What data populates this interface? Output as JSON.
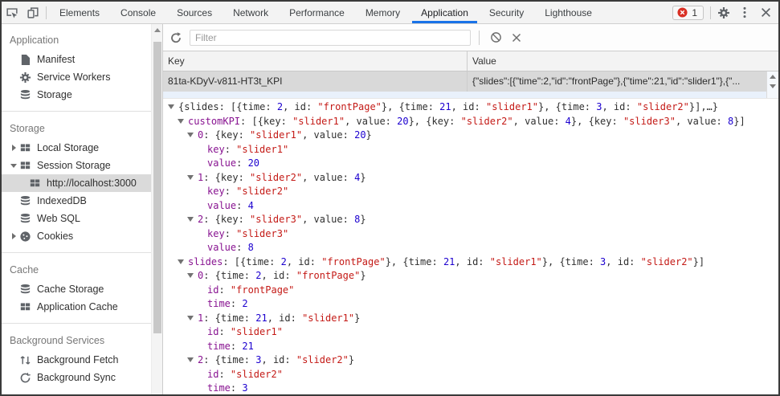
{
  "colors": {
    "accent_blue": "#1a73e8",
    "error_red": "#d93025",
    "syntax_key_purple": "#881391",
    "syntax_string_red": "#c41a16",
    "syntax_number_blue": "#1c00cf",
    "selected_row_gray": "#d9d9d9",
    "row_stripe_blue": "#e9f1fb"
  },
  "tabbar": {
    "tabs": [
      "Elements",
      "Console",
      "Sources",
      "Network",
      "Performance",
      "Memory",
      "Application",
      "Security",
      "Lighthouse"
    ],
    "active_tab": "Application",
    "error_badge_count": "1",
    "icons_left": [
      "inspect-icon",
      "device-toolbar-icon"
    ],
    "icons_right": [
      "settings-gear-icon",
      "more-menu-icon",
      "close-icon"
    ]
  },
  "sidebar": {
    "sections": [
      {
        "title": "Application",
        "items": [
          {
            "label": "Manifest",
            "icon": "file-icon"
          },
          {
            "label": "Service Workers",
            "icon": "gear-icon"
          },
          {
            "label": "Storage",
            "icon": "database-icon"
          }
        ]
      },
      {
        "title": "Storage",
        "items": [
          {
            "label": "Local Storage",
            "icon": "grid-icon",
            "expander": "collapsed"
          },
          {
            "label": "Session Storage",
            "icon": "grid-icon",
            "expander": "expanded"
          },
          {
            "label": "http://localhost:3000",
            "icon": "grid-icon",
            "selected": true,
            "child": true
          },
          {
            "label": "IndexedDB",
            "icon": "database-icon"
          },
          {
            "label": "Web SQL",
            "icon": "database-icon"
          },
          {
            "label": "Cookies",
            "icon": "cookie-icon",
            "expander": "collapsed"
          }
        ]
      },
      {
        "title": "Cache",
        "items": [
          {
            "label": "Cache Storage",
            "icon": "database-icon"
          },
          {
            "label": "Application Cache",
            "icon": "grid-icon"
          }
        ]
      },
      {
        "title": "Background Services",
        "items": [
          {
            "label": "Background Fetch",
            "icon": "fetch-icon"
          },
          {
            "label": "Background Sync",
            "icon": "sync-icon"
          }
        ]
      }
    ]
  },
  "main": {
    "toolbar": {
      "filter_placeholder": "Filter",
      "icons": [
        "refresh-icon",
        "block-icon",
        "delete-icon"
      ]
    },
    "grid": {
      "columns": [
        "Key",
        "Value"
      ],
      "selected_row": {
        "key": "81ta-KDyV-v811-HT3t_KPI",
        "value": "{\"slides\":[{\"time\":2,\"id\":\"frontPage\"},{\"time\":21,\"id\":\"slider1\"},{\"..."
      }
    },
    "preview_tree": {
      "lines": [
        {
          "i": 0,
          "e": 1,
          "s": [
            [
              "p",
              "{slides: [{time: "
            ],
            [
              "n",
              "2"
            ],
            [
              "p",
              ", id: "
            ],
            [
              "s",
              "\"frontPage\""
            ],
            [
              "p",
              "}, {time: "
            ],
            [
              "n",
              "21"
            ],
            [
              "p",
              ", id: "
            ],
            [
              "s",
              "\"slider1\""
            ],
            [
              "p",
              "}, {time: "
            ],
            [
              "n",
              "3"
            ],
            [
              "p",
              ", id: "
            ],
            [
              "s",
              "\"slider2\""
            ],
            [
              "p",
              "}],…}"
            ]
          ]
        },
        {
          "i": 1,
          "e": 1,
          "s": [
            [
              "k",
              "customKPI"
            ],
            [
              "p",
              ": [{key: "
            ],
            [
              "s",
              "\"slider1\""
            ],
            [
              "p",
              ", value: "
            ],
            [
              "n",
              "20"
            ],
            [
              "p",
              "}, {key: "
            ],
            [
              "s",
              "\"slider2\""
            ],
            [
              "p",
              ", value: "
            ],
            [
              "n",
              "4"
            ],
            [
              "p",
              "}, {key: "
            ],
            [
              "s",
              "\"slider3\""
            ],
            [
              "p",
              ", value: "
            ],
            [
              "n",
              "8"
            ],
            [
              "p",
              "}]"
            ]
          ]
        },
        {
          "i": 2,
          "e": 1,
          "s": [
            [
              "k",
              "0"
            ],
            [
              "p",
              ": {key: "
            ],
            [
              "s",
              "\"slider1\""
            ],
            [
              "p",
              ", value: "
            ],
            [
              "n",
              "20"
            ],
            [
              "p",
              "}"
            ]
          ]
        },
        {
          "i": 3,
          "e": 0,
          "s": [
            [
              "k",
              "key"
            ],
            [
              "p",
              ": "
            ],
            [
              "s",
              "\"slider1\""
            ]
          ]
        },
        {
          "i": 3,
          "e": 0,
          "s": [
            [
              "k",
              "value"
            ],
            [
              "p",
              ": "
            ],
            [
              "n",
              "20"
            ]
          ]
        },
        {
          "i": 2,
          "e": 1,
          "s": [
            [
              "k",
              "1"
            ],
            [
              "p",
              ": {key: "
            ],
            [
              "s",
              "\"slider2\""
            ],
            [
              "p",
              ", value: "
            ],
            [
              "n",
              "4"
            ],
            [
              "p",
              "}"
            ]
          ]
        },
        {
          "i": 3,
          "e": 0,
          "s": [
            [
              "k",
              "key"
            ],
            [
              "p",
              ": "
            ],
            [
              "s",
              "\"slider2\""
            ]
          ]
        },
        {
          "i": 3,
          "e": 0,
          "s": [
            [
              "k",
              "value"
            ],
            [
              "p",
              ": "
            ],
            [
              "n",
              "4"
            ]
          ]
        },
        {
          "i": 2,
          "e": 1,
          "s": [
            [
              "k",
              "2"
            ],
            [
              "p",
              ": {key: "
            ],
            [
              "s",
              "\"slider3\""
            ],
            [
              "p",
              ", value: "
            ],
            [
              "n",
              "8"
            ],
            [
              "p",
              "}"
            ]
          ]
        },
        {
          "i": 3,
          "e": 0,
          "s": [
            [
              "k",
              "key"
            ],
            [
              "p",
              ": "
            ],
            [
              "s",
              "\"slider3\""
            ]
          ]
        },
        {
          "i": 3,
          "e": 0,
          "s": [
            [
              "k",
              "value"
            ],
            [
              "p",
              ": "
            ],
            [
              "n",
              "8"
            ]
          ]
        },
        {
          "i": 1,
          "e": 1,
          "s": [
            [
              "k",
              "slides"
            ],
            [
              "p",
              ": [{time: "
            ],
            [
              "n",
              "2"
            ],
            [
              "p",
              ", id: "
            ],
            [
              "s",
              "\"frontPage\""
            ],
            [
              "p",
              "}, {time: "
            ],
            [
              "n",
              "21"
            ],
            [
              "p",
              ", id: "
            ],
            [
              "s",
              "\"slider1\""
            ],
            [
              "p",
              "}, {time: "
            ],
            [
              "n",
              "3"
            ],
            [
              "p",
              ", id: "
            ],
            [
              "s",
              "\"slider2\""
            ],
            [
              "p",
              "}]"
            ]
          ]
        },
        {
          "i": 2,
          "e": 1,
          "s": [
            [
              "k",
              "0"
            ],
            [
              "p",
              ": {time: "
            ],
            [
              "n",
              "2"
            ],
            [
              "p",
              ", id: "
            ],
            [
              "s",
              "\"frontPage\""
            ],
            [
              "p",
              "}"
            ]
          ]
        },
        {
          "i": 3,
          "e": 0,
          "s": [
            [
              "k",
              "id"
            ],
            [
              "p",
              ": "
            ],
            [
              "s",
              "\"frontPage\""
            ]
          ]
        },
        {
          "i": 3,
          "e": 0,
          "s": [
            [
              "k",
              "time"
            ],
            [
              "p",
              ": "
            ],
            [
              "n",
              "2"
            ]
          ]
        },
        {
          "i": 2,
          "e": 1,
          "s": [
            [
              "k",
              "1"
            ],
            [
              "p",
              ": {time: "
            ],
            [
              "n",
              "21"
            ],
            [
              "p",
              ", id: "
            ],
            [
              "s",
              "\"slider1\""
            ],
            [
              "p",
              "}"
            ]
          ]
        },
        {
          "i": 3,
          "e": 0,
          "s": [
            [
              "k",
              "id"
            ],
            [
              "p",
              ": "
            ],
            [
              "s",
              "\"slider1\""
            ]
          ]
        },
        {
          "i": 3,
          "e": 0,
          "s": [
            [
              "k",
              "time"
            ],
            [
              "p",
              ": "
            ],
            [
              "n",
              "21"
            ]
          ]
        },
        {
          "i": 2,
          "e": 1,
          "s": [
            [
              "k",
              "2"
            ],
            [
              "p",
              ": {time: "
            ],
            [
              "n",
              "3"
            ],
            [
              "p",
              ", id: "
            ],
            [
              "s",
              "\"slider2\""
            ],
            [
              "p",
              "}"
            ]
          ]
        },
        {
          "i": 3,
          "e": 0,
          "s": [
            [
              "k",
              "id"
            ],
            [
              "p",
              ": "
            ],
            [
              "s",
              "\"slider2\""
            ]
          ]
        },
        {
          "i": 3,
          "e": 0,
          "s": [
            [
              "k",
              "time"
            ],
            [
              "p",
              ": "
            ],
            [
              "n",
              "3"
            ]
          ]
        }
      ]
    }
  }
}
